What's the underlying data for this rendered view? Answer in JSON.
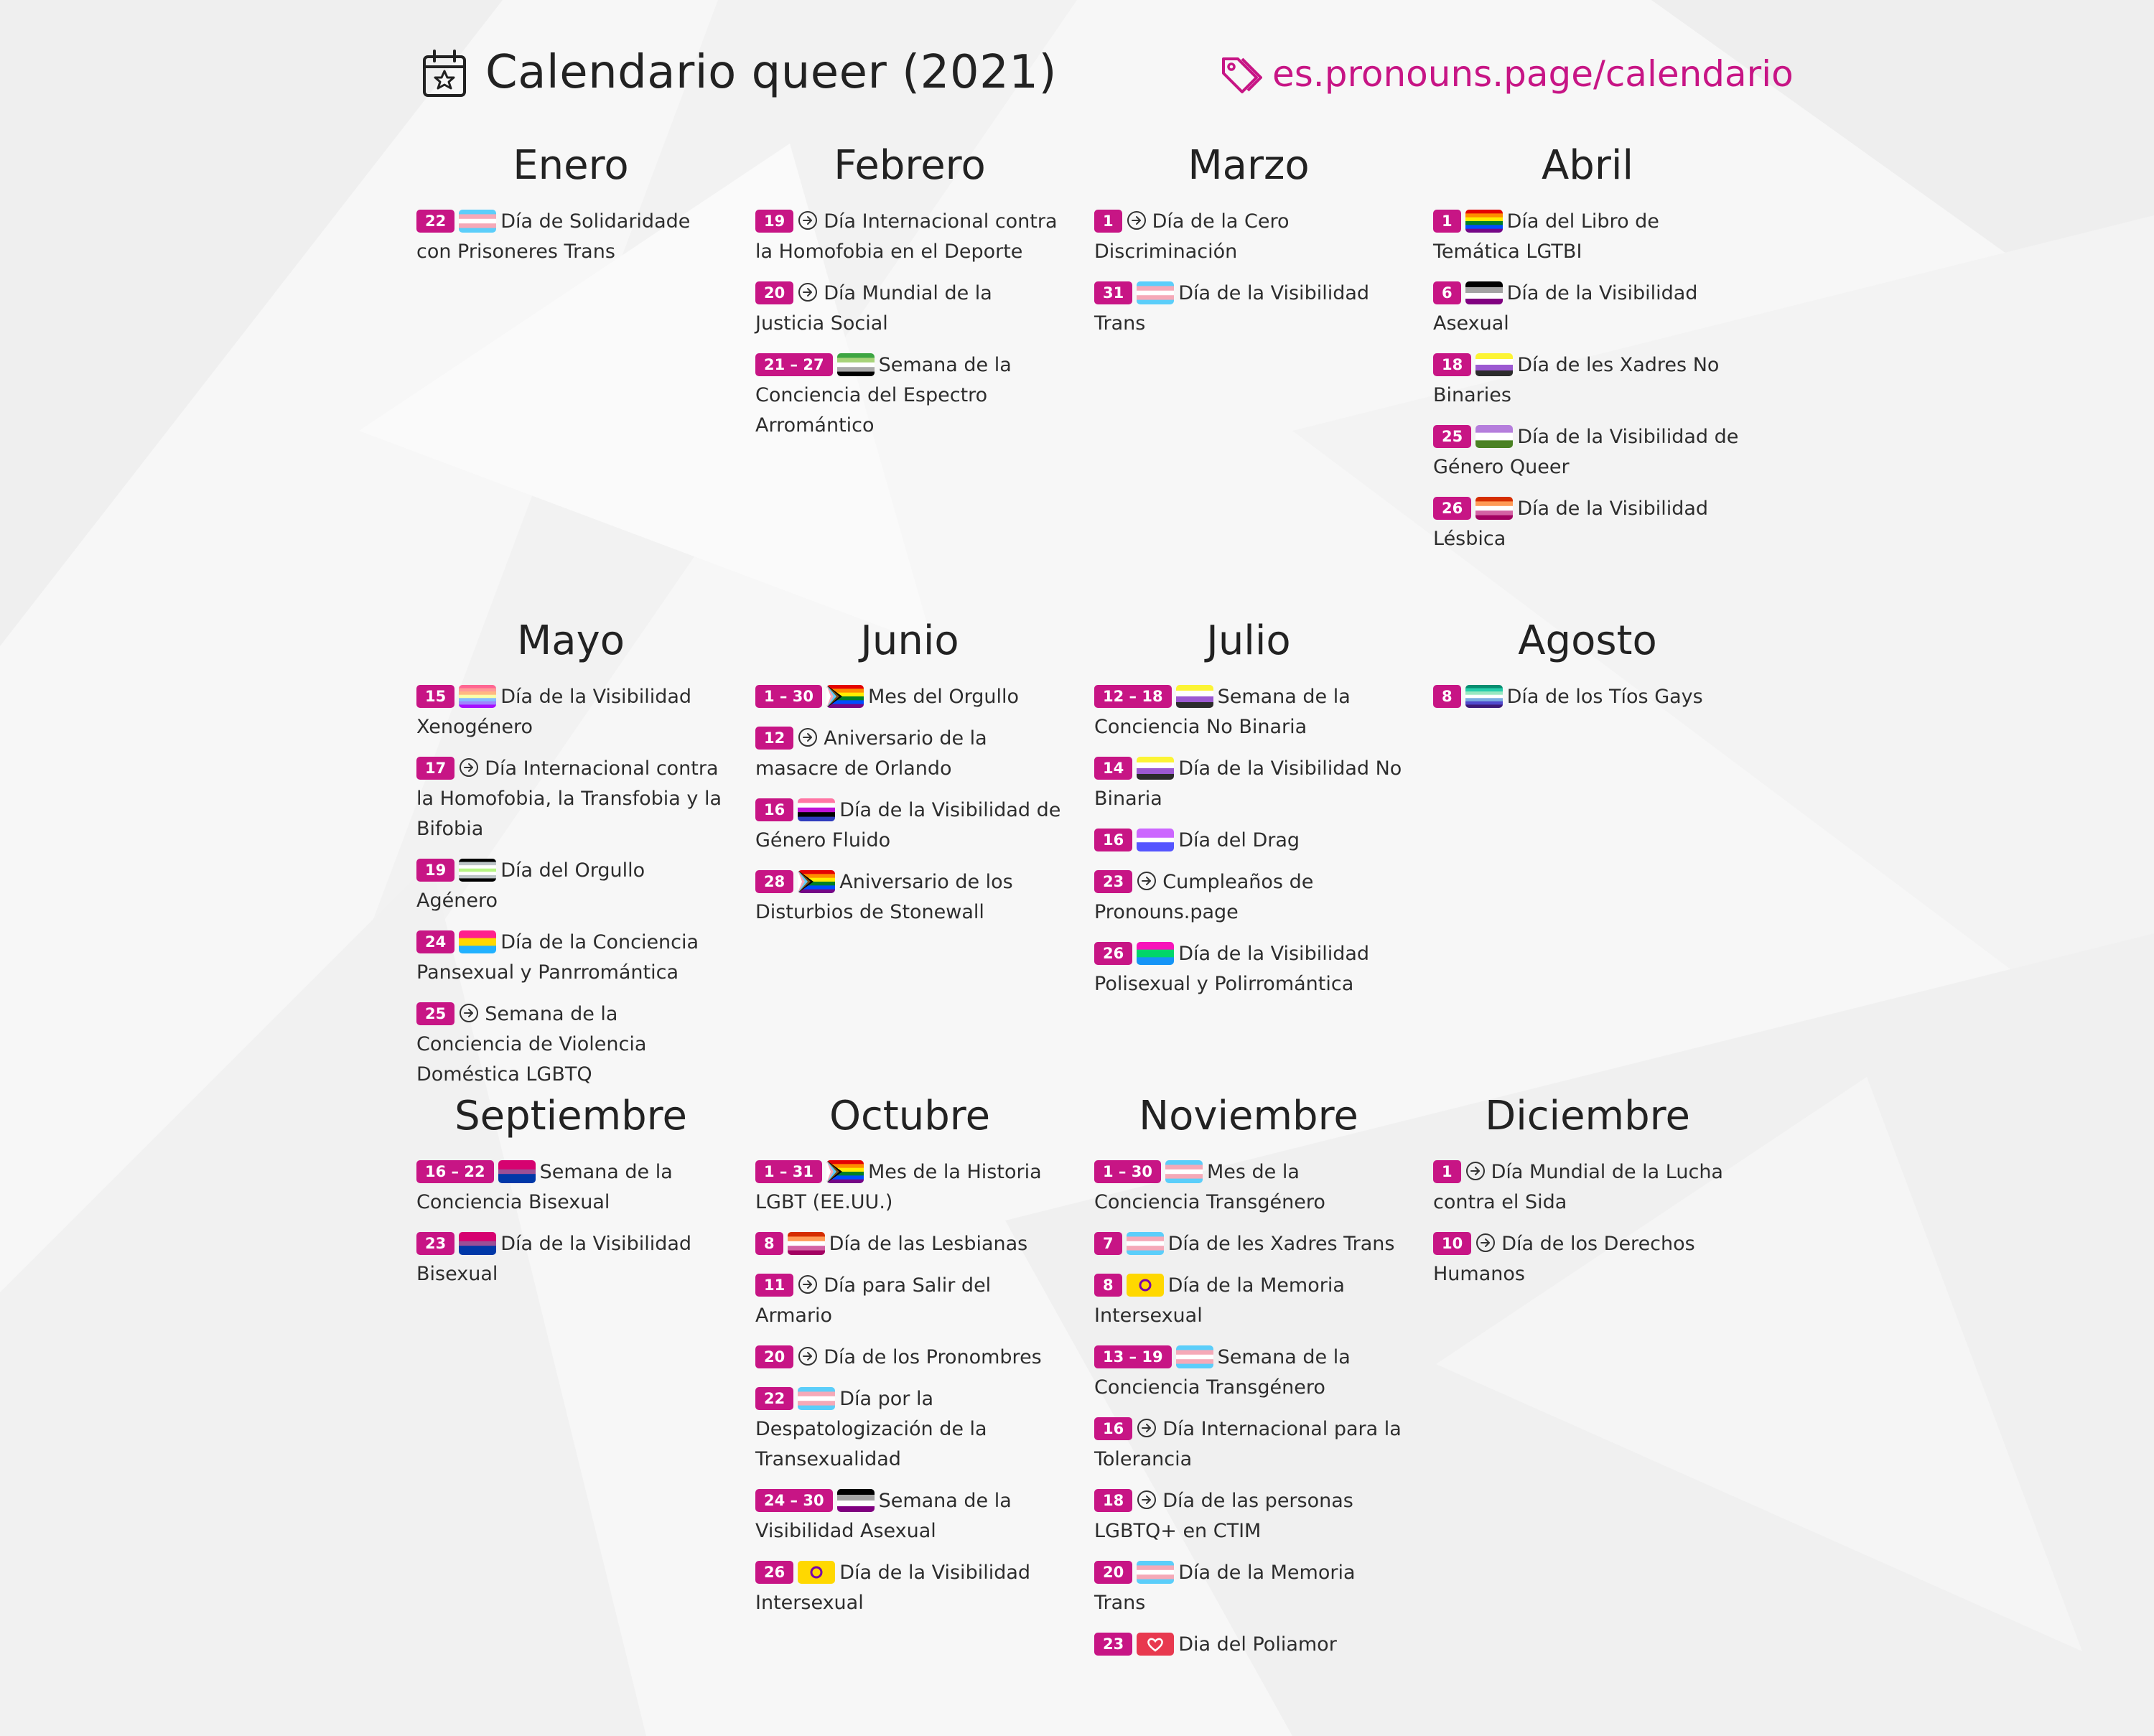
{
  "header": {
    "title": "Calendario queer (2021)",
    "url": "es.pronouns.page/calendario",
    "accent_color": "#c71585"
  },
  "months": [
    {
      "name": "Enero",
      "events": [
        {
          "date": "22",
          "icon": "trans-flag",
          "text": "Día de Solidaridade con Prisoneres Trans"
        }
      ]
    },
    {
      "name": "Febrero",
      "events": [
        {
          "date": "19",
          "icon": "arrow-circle",
          "text": "Día Internacional contra la Homofobia en el Deporte"
        },
        {
          "date": "20",
          "icon": "arrow-circle",
          "text": "Día Mundial de la Justicia Social"
        },
        {
          "date": "21 – 27",
          "icon": "aromantic-flag",
          "text": "Semana de la Conciencia del Espectro Arromántico"
        }
      ]
    },
    {
      "name": "Marzo",
      "events": [
        {
          "date": "1",
          "icon": "arrow-circle",
          "text": "Día de la Cero Discriminación"
        },
        {
          "date": "31",
          "icon": "trans-flag",
          "text": "Día de la Visibilidad Trans"
        }
      ]
    },
    {
      "name": "Abril",
      "events": [
        {
          "date": "1",
          "icon": "rainbow-flag",
          "text": "Día del Libro de Temática LGTBI"
        },
        {
          "date": "6",
          "icon": "asexual-flag",
          "text": "Día de la Visibilidad Asexual"
        },
        {
          "date": "18",
          "icon": "nonbinary-flag",
          "text": "Día de les Xadres No Binaries"
        },
        {
          "date": "25",
          "icon": "genderqueer-flag",
          "text": "Día de la Visibilidad de Género Queer"
        },
        {
          "date": "26",
          "icon": "lesbian-flag",
          "text": "Día de la Visibilidad Lésbica"
        }
      ]
    },
    {
      "name": "Mayo",
      "events": [
        {
          "date": "15",
          "icon": "xenogender-flag",
          "text": "Día de la Visibilidad Xenogénero"
        },
        {
          "date": "17",
          "icon": "arrow-circle",
          "text": "Día Internacional contra la Homofobia, la Transfobia y la Bifobia"
        },
        {
          "date": "19",
          "icon": "agender-flag",
          "text": "Día del Orgullo Agénero"
        },
        {
          "date": "24",
          "icon": "pansexual-flag",
          "text": "Día de la Conciencia Pansexual y Panrromántica"
        },
        {
          "date": "25",
          "icon": "arrow-circle",
          "text": "Semana de la Conciencia de Violencia Doméstica LGBTQ"
        }
      ]
    },
    {
      "name": "Junio",
      "events": [
        {
          "date": "1 – 30",
          "icon": "progress-flag",
          "text": "Mes del Orgullo"
        },
        {
          "date": "12",
          "icon": "arrow-circle",
          "text": "Aniversario de la masacre de Orlando"
        },
        {
          "date": "16",
          "icon": "genderfluid-flag",
          "text": "Día de la Visibilidad de Género Fluido"
        },
        {
          "date": "28",
          "icon": "progress-flag",
          "text": "Aniversario de los Disturbios de Stonewall"
        }
      ]
    },
    {
      "name": "Julio",
      "events": [
        {
          "date": "12 – 18",
          "icon": "nonbinary-flag",
          "text": "Semana de la Conciencia No Binaria"
        },
        {
          "date": "14",
          "icon": "nonbinary-flag",
          "text": "Día de la Visibilidad No Binaria"
        },
        {
          "date": "16",
          "icon": "drag-flag",
          "text": "Día del Drag"
        },
        {
          "date": "23",
          "icon": "arrow-circle",
          "text": "Cumpleaños de Pronouns.page"
        },
        {
          "date": "26",
          "icon": "polysexual-flag",
          "text": "Día de la Visibilidad Polisexual y Polirromántica"
        }
      ]
    },
    {
      "name": "Agosto",
      "events": [
        {
          "date": "8",
          "icon": "gay-men-flag",
          "text": "Día de los Tíos Gays"
        }
      ]
    },
    {
      "name": "Septiembre",
      "events": [
        {
          "date": "16 – 22",
          "icon": "bisexual-flag",
          "text": "Semana de la Conciencia Bisexual"
        },
        {
          "date": "23",
          "icon": "bisexual-flag",
          "text": "Día de la Visibilidad Bisexual"
        }
      ]
    },
    {
      "name": "Octubre",
      "events": [
        {
          "date": "1 – 31",
          "icon": "progress-flag",
          "text": "Mes de la Historia LGBT (EE.UU.)"
        },
        {
          "date": "8",
          "icon": "lesbian-flag",
          "text": "Día de las Lesbianas"
        },
        {
          "date": "11",
          "icon": "arrow-circle",
          "text": "Día para Salir del Armario"
        },
        {
          "date": "20",
          "icon": "arrow-circle",
          "text": "Día de los Pronombres"
        },
        {
          "date": "22",
          "icon": "trans-flag",
          "text": "Día por la Despatologización de la Transexualidad"
        },
        {
          "date": "24 – 30",
          "icon": "asexual-flag",
          "text": "Semana de la Visibilidad Asexual"
        },
        {
          "date": "26",
          "icon": "intersex-flag",
          "text": "Día de la Visibilidad Intersexual"
        }
      ]
    },
    {
      "name": "Noviembre",
      "events": [
        {
          "date": "1 – 30",
          "icon": "trans-flag",
          "text": "Mes de la Conciencia Transgénero"
        },
        {
          "date": "7",
          "icon": "trans-flag",
          "text": "Día de les Xadres Trans"
        },
        {
          "date": "8",
          "icon": "intersex-flag",
          "text": "Día de la Memoria Intersexual"
        },
        {
          "date": "13 – 19",
          "icon": "trans-flag",
          "text": "Semana de la Conciencia Transgénero"
        },
        {
          "date": "16",
          "icon": "arrow-circle",
          "text": "Día Internacional para la Tolerancia"
        },
        {
          "date": "18",
          "icon": "arrow-circle",
          "text": "Día de las personas LGBTQ+ en CTIM"
        },
        {
          "date": "20",
          "icon": "trans-flag",
          "text": "Día de la Memoria Trans"
        },
        {
          "date": "23",
          "icon": "polyamory-flag",
          "text": "Dia del Poliamor"
        }
      ]
    },
    {
      "name": "Diciembre",
      "events": [
        {
          "date": "1",
          "icon": "arrow-circle",
          "text": "Día Mundial de la Lucha contra el Sida"
        },
        {
          "date": "10",
          "icon": "arrow-circle",
          "text": "Día de los Derechos Humanos"
        }
      ]
    }
  ]
}
